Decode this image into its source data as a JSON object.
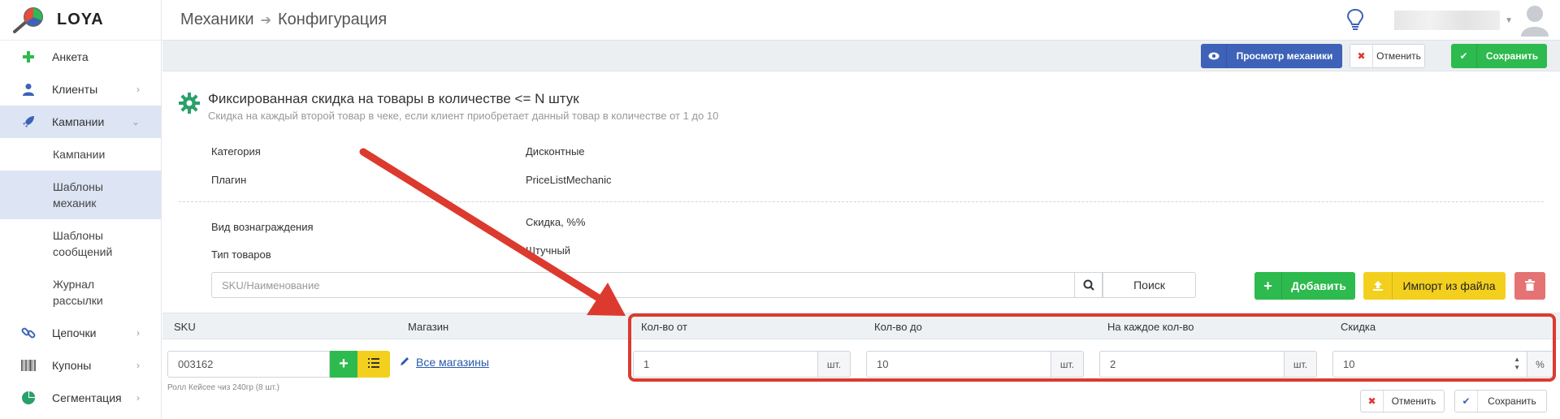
{
  "app": {
    "name": "LOYA"
  },
  "colors": {
    "primary": "#3d62b8",
    "success": "#2dba4e",
    "warning": "#f4d01e",
    "danger": "#e57373",
    "accent_red": "#dc3a2f",
    "active_bg": "#dde5f4"
  },
  "sidebar": {
    "items": [
      {
        "label": "Анкета",
        "icon": "plus-icon"
      },
      {
        "label": "Клиенты",
        "icon": "user-icon"
      },
      {
        "label": "Кампании",
        "icon": "rocket-icon"
      },
      {
        "label": "Кампании"
      },
      {
        "label": "Шаблоны механик"
      },
      {
        "label": "Шаблоны сообщений"
      },
      {
        "label": "Журнал рассылки"
      },
      {
        "label": "Цепочки",
        "icon": "chain-icon"
      },
      {
        "label": "Купоны",
        "icon": "barcode-icon"
      },
      {
        "label": "Сегментация",
        "icon": "pie-chart-icon"
      }
    ]
  },
  "breadcrumb": {
    "part1": "Механики",
    "part2": "Конфигурация"
  },
  "actions": {
    "preview": "Просмотр механики",
    "cancel": "Отменить",
    "save": "Сохранить"
  },
  "mechanic": {
    "title": "Фиксированная скидка на товары в количестве <= N штук",
    "subtitle": "Скидка на каждый второй товар в чеке, если клиент приобретает данный товар в количестве от 1 до 10",
    "fields": [
      {
        "label": "Категория",
        "value": "Дисконтные"
      },
      {
        "label": "Плагин",
        "value": "PriceListMechanic"
      },
      {
        "label": "Вид вознаграждения",
        "value": "Скидка, %%"
      },
      {
        "label": "Тип товаров",
        "value": "Штучный"
      }
    ]
  },
  "search": {
    "placeholder": "SKU/Наименование",
    "button": "Поиск"
  },
  "toolbar": {
    "add": "Добавить",
    "import": "Импорт из файла"
  },
  "table": {
    "headers": [
      "SKU",
      "Магазин",
      "Кол-во от",
      "Кол-во до",
      "На каждое кол-во",
      "Скидка"
    ],
    "row": {
      "sku": "003162",
      "caption": "Ролл Кейсее чиз 240гр (8 шт.)",
      "store": "Все магазины",
      "qty_from": "1",
      "qty_to": "10",
      "each": "2",
      "discount": "10",
      "unit": "шт.",
      "percent": "%"
    }
  },
  "row_actions": {
    "cancel": "Отменить",
    "save": "Сохранить"
  }
}
